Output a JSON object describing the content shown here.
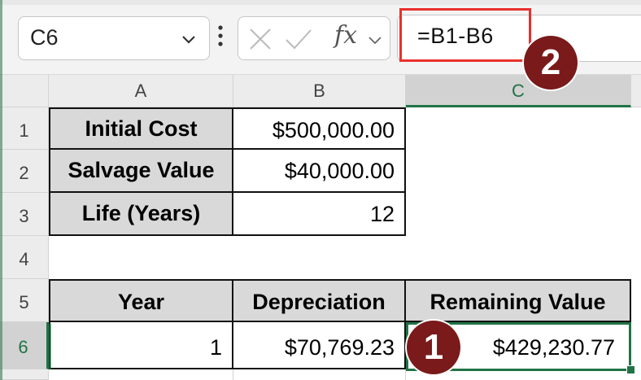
{
  "formula_bar": {
    "name_box": "C6",
    "fx_label": "fx",
    "formula": "=B1-B6"
  },
  "columns": [
    "A",
    "B",
    "C"
  ],
  "rows": [
    "1",
    "2",
    "3",
    "4",
    "5",
    "6"
  ],
  "cells": {
    "A1": "Initial Cost",
    "B1": "$500,000.00",
    "A2": "Salvage Value",
    "B2": "$40,000.00",
    "A3": "Life (Years)",
    "B3": "12",
    "A5": "Year",
    "B5": "Depreciation",
    "C5": "Remaining Value",
    "A6": "1",
    "B6": "$70,769.23",
    "C6": "$429,230.77"
  },
  "annotations": {
    "badge_1": "1",
    "badge_2": "2"
  },
  "colors": {
    "accent_green": "#217346",
    "highlight_red": "#e8302d",
    "badge_maroon": "#7a1a1a"
  },
  "icons": {
    "name_box_dropdown": "chevron-down-icon",
    "more_options": "vertical-dots-icon",
    "cancel": "close-icon",
    "enter": "checkmark-icon",
    "insert_function": "fx-icon"
  }
}
